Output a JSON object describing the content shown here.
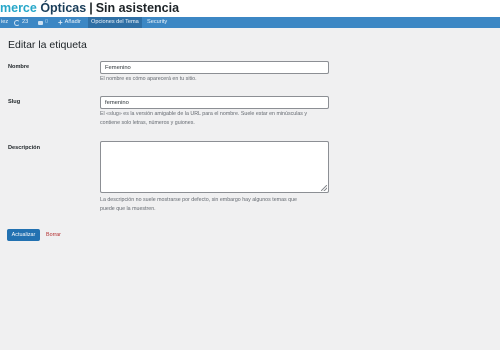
{
  "brand": {
    "part1": "merce",
    "part2": "Ópticas",
    "separator": "|",
    "tagline": "Sin asistencia"
  },
  "adminbar": {
    "user_fragment": "iez",
    "updates_count": "23",
    "comments_count": "0",
    "add_new": "Añadir",
    "theme_options": "Opciones del Tema",
    "security": "Security"
  },
  "page": {
    "title": "Editar la etiqueta"
  },
  "form": {
    "name_label": "Nombre",
    "name_value": "Femenino",
    "name_help": "El nombre es cómo aparecerá en tu sitio.",
    "slug_label": "Slug",
    "slug_value": "femenino",
    "slug_help_1": "El «slug» es la versión amigable de la URL para el nombre. Suele estar en minúsculas y",
    "slug_help_2": "contiene solo letras, números y guiones.",
    "description_label": "Descripción",
    "description_value": "",
    "description_help_1": "La descripción no suele mostrarse por defecto, sin embargo hay algunos temas que",
    "description_help_2": "puede que la muestren."
  },
  "actions": {
    "update_label": "Actualizar",
    "delete_label": "Borrar"
  },
  "colors": {
    "adminbar": "#3c87c4",
    "primary": "#2271b1",
    "delete": "#b32d2e",
    "brand_accent": "#27a7c9"
  }
}
